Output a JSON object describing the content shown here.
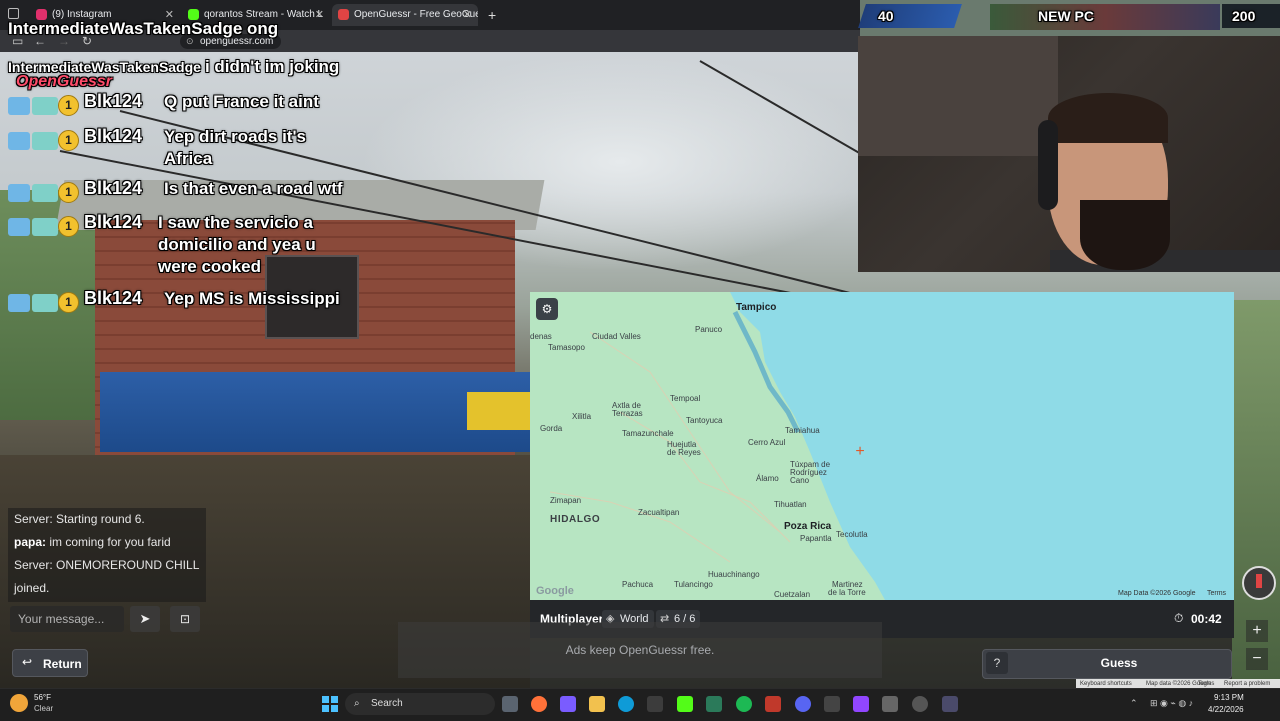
{
  "browser": {
    "tabs": [
      {
        "label": "(9) Instagram",
        "color": "#e1306c"
      },
      {
        "label": "qorantos Stream - Watch L",
        "color": "#53fc18"
      },
      {
        "label": "OpenGuessr - Free GeoGue",
        "color": "#e04444"
      }
    ],
    "new_tab": "+",
    "url": "openguessr.com"
  },
  "stream": {
    "title_user": "IntermediateWasTakenSadge ong",
    "reply_user": "IntermediateWasTakenSadge",
    "reply_text": "i didn't im joking",
    "logo": "OpenGuessr",
    "coin": "1",
    "messages": [
      {
        "user": "Blk124",
        "text": "Q put France it aint"
      },
      {
        "user": "Blk124",
        "text": "Yep dirt roads it's Africa"
      },
      {
        "user": "Blk124",
        "text": "Is that even a road wtf"
      },
      {
        "user": "Blk124",
        "text": "I saw the servicio a domicilio and yea u were cooked"
      },
      {
        "user": "Blk124",
        "text": "Yep MS is Mississippi"
      }
    ],
    "counter_left": "40",
    "counter_mid": "NEW PC",
    "counter_right": "200"
  },
  "map": {
    "places": [
      {
        "name": "Tampico",
        "kind": "big"
      },
      {
        "name": "Ciudad Valles",
        "kind": "city"
      },
      {
        "name": "Panuco",
        "kind": "city"
      },
      {
        "name": "Tamasopo",
        "kind": "city"
      },
      {
        "name": "denas",
        "kind": "city"
      },
      {
        "name": "Tempoal",
        "kind": "city"
      },
      {
        "name": "Axtla de",
        "kind": "city"
      },
      {
        "name": "Terrazas",
        "kind": "city"
      },
      {
        "name": "Xilitla",
        "kind": "city"
      },
      {
        "name": "Tantoyuca",
        "kind": "city"
      },
      {
        "name": "Tamiahua",
        "kind": "city"
      },
      {
        "name": "Tamazunchale",
        "kind": "city"
      },
      {
        "name": "Cerro Azul",
        "kind": "city"
      },
      {
        "name": "Huejutla",
        "kind": "city"
      },
      {
        "name": "de Reyes",
        "kind": "city"
      },
      {
        "name": "Gorda",
        "kind": "city"
      },
      {
        "name": "Túxpam de",
        "kind": "city"
      },
      {
        "name": "Rodríguez",
        "kind": "city"
      },
      {
        "name": "Cano",
        "kind": "city"
      },
      {
        "name": "Álamo",
        "kind": "city"
      },
      {
        "name": "Tihuatlan",
        "kind": "city"
      },
      {
        "name": "Zimapan",
        "kind": "city"
      },
      {
        "name": "Zacualtipan",
        "kind": "city"
      },
      {
        "name": "HIDALGO",
        "kind": "state"
      },
      {
        "name": "Poza Rica",
        "kind": "big"
      },
      {
        "name": "Papantla",
        "kind": "city"
      },
      {
        "name": "Tecolutla",
        "kind": "city"
      },
      {
        "name": "Huauchinango",
        "kind": "city"
      },
      {
        "name": "Pachuca",
        "kind": "city"
      },
      {
        "name": "Tulancingo",
        "kind": "city"
      },
      {
        "name": "Cuetzalan",
        "kind": "city"
      },
      {
        "name": "Martinez",
        "kind": "city"
      },
      {
        "name": "de la Torre",
        "kind": "city"
      }
    ],
    "highways": [
      "70",
      "110",
      "70",
      "127",
      "105",
      "85",
      "180",
      "106",
      "120",
      "85",
      "105",
      "130",
      "132D",
      "180",
      "180",
      "129",
      "85"
    ],
    "google": "Google",
    "attribution": "Map Data ©2026 Google",
    "terms": "Terms",
    "settings_icon": "sliders-icon",
    "water_color": "#8fdbe7",
    "land_color": "#b5e4c0"
  },
  "game": {
    "mode": "Multiplayer",
    "scope": "World",
    "rounds": "6 / 6",
    "timer": "00:42",
    "ads": "Ads keep OpenGuessr free.",
    "help": "?",
    "guess": "Guess",
    "zoom_in": "+",
    "zoom_out": "−",
    "return": "Return"
  },
  "chat": {
    "lines": [
      {
        "text": "Server: Starting round 6."
      },
      {
        "user": "papa:",
        "text": " im coming for you farid"
      },
      {
        "text": "Server: ONEMOREROUND CHILL"
      },
      {
        "text": "joined."
      }
    ],
    "placeholder": "Your message..."
  },
  "taskbar": {
    "temp": "56°F",
    "condition": "Clear",
    "search": "Search",
    "time": "9:13 PM",
    "date": "4/22/2026",
    "footer_links": [
      "Keyboard shortcuts",
      "Map data ©2026 Google",
      "Terms",
      "Report a problem"
    ]
  }
}
